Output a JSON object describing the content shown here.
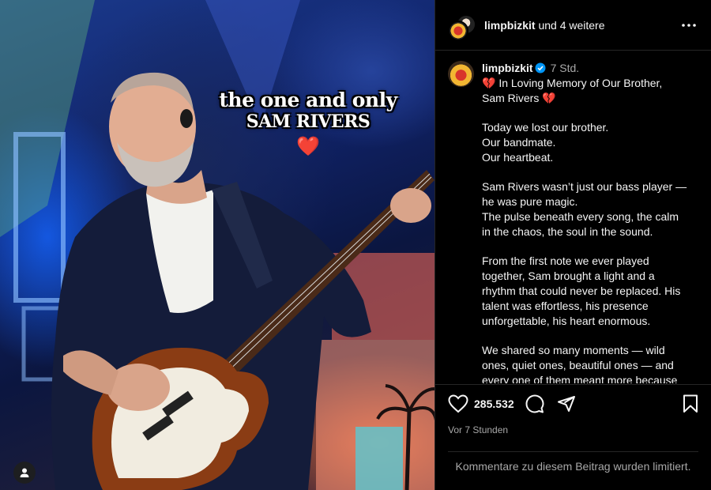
{
  "post": {
    "overlay_line1": "the one and only",
    "overlay_line2": "SAM RIVERS",
    "overlay_heart": "❤️"
  },
  "header": {
    "username": "limpbizkit",
    "collab_suffix": "und 4 weitere",
    "more_icon": "more-horizontal-icon"
  },
  "caption": {
    "username": "limpbizkit",
    "time": "7 Std.",
    "heart_emoji": "💔",
    "title_line1": "In Loving Memory of Our Brother,",
    "title_line2": "Sam Rivers",
    "p1": [
      "Today we lost our brother.",
      "Our bandmate.",
      "Our heartbeat."
    ],
    "p2": [
      "Sam Rivers wasn’t just our bass player —",
      "he was pure magic.",
      "The pulse beneath every song, the calm",
      "in the chaos, the soul in the sound."
    ],
    "p3": [
      "From the first note we ever played",
      "together, Sam brought a light and a",
      "rhythm that could never be replaced. His",
      "talent was effortless, his presence",
      "unforgettable, his heart enormous."
    ],
    "p4": [
      "We shared so many moments — wild",
      "ones, quiet ones, beautiful ones — and",
      "every one of them meant more because"
    ]
  },
  "actions": {
    "likes": "285.532",
    "timestamp": "Vor 7 Stunden"
  },
  "comments": {
    "disabled_text": "Kommentare zu diesem Beitrag wurden limitiert."
  },
  "colors": {
    "background": "#000000",
    "text": "#f5f5f5",
    "secondary": "#a8a8a8",
    "verified": "#0095f6",
    "divider": "#262626"
  }
}
